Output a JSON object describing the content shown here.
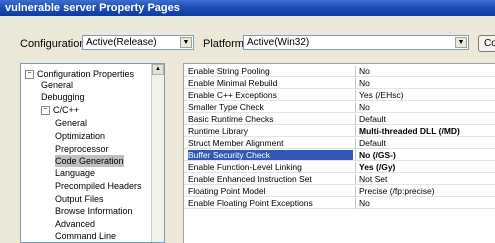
{
  "window": {
    "title": "vulnerable server Property Pages"
  },
  "config": {
    "configuration_label": "Configuration:",
    "configuration_value": "Active(Release)",
    "platform_label": "Platform:",
    "platform_value": "Active(Win32)",
    "button_label": "Co"
  },
  "tree": {
    "items": [
      {
        "label": "Configuration Properties",
        "expander": "−",
        "selected": false
      },
      {
        "label": "General",
        "selected": false
      },
      {
        "label": "Debugging",
        "selected": false
      },
      {
        "label": "C/C++",
        "expander": "−",
        "selected": false
      },
      {
        "label": "General",
        "selected": false
      },
      {
        "label": "Optimization",
        "selected": false
      },
      {
        "label": "Preprocessor",
        "selected": false
      },
      {
        "label": "Code Generation",
        "selected": true
      },
      {
        "label": "Language",
        "selected": false
      },
      {
        "label": "Precompiled Headers",
        "selected": false
      },
      {
        "label": "Output Files",
        "selected": false
      },
      {
        "label": "Browse Information",
        "selected": false
      },
      {
        "label": "Advanced",
        "selected": false
      },
      {
        "label": "Command Line",
        "selected": false
      }
    ]
  },
  "properties": {
    "rows": [
      {
        "name": "Enable String Pooling",
        "value": "No"
      },
      {
        "name": "Enable Minimal Rebuild",
        "value": "No"
      },
      {
        "name": "Enable C++ Exceptions",
        "value": "Yes (/EHsc)"
      },
      {
        "name": "Smaller Type Check",
        "value": "No"
      },
      {
        "name": "Basic Runtime Checks",
        "value": "Default"
      },
      {
        "name": "Runtime Library",
        "value": "Multi-threaded DLL (/MD)",
        "bold": true
      },
      {
        "name": "Struct Member Alignment",
        "value": "Default"
      },
      {
        "name": "Buffer Security Check",
        "value": "No (/GS-)",
        "bold": true,
        "selected": true
      },
      {
        "name": "Enable Function-Level Linking",
        "value": "Yes (/Gy)",
        "bold": true
      },
      {
        "name": "Enable Enhanced Instruction Set",
        "value": "Not Set"
      },
      {
        "name": "Floating Point Model",
        "value": "Precise (/fp:precise)"
      },
      {
        "name": "Enable Floating Point Exceptions",
        "value": "No"
      }
    ]
  },
  "colors": {
    "titlebar": "#1f4fb4",
    "selection": "#2f59b4",
    "tree_selection": "#c0c0c0"
  }
}
